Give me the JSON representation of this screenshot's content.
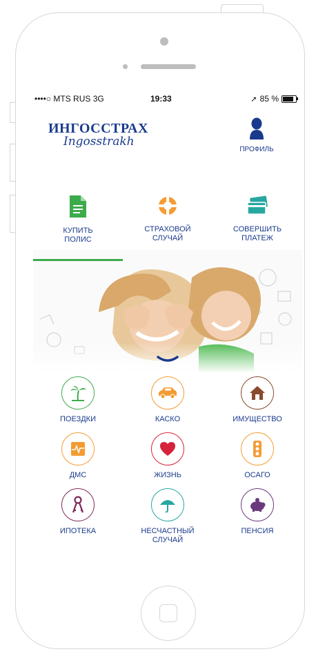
{
  "status_bar": {
    "carrier": "••••○ MTS RUS  3G",
    "time": "19:33",
    "battery": "85 %"
  },
  "header": {
    "logo_line1": "ИНГОССТРАХ",
    "logo_line2": "Ingosstrakh",
    "profile_label": "ПРОФИЛЬ"
  },
  "actions": [
    {
      "label": "КУПИТЬ\nПОЛИС",
      "icon": "document-icon"
    },
    {
      "label": "СТРАХОВОЙ\nСЛУЧАЙ",
      "icon": "lifebuoy-icon"
    },
    {
      "label": "СОВЕРШИТЬ\nПЛАТЕЖ",
      "icon": "card-icon"
    }
  ],
  "categories": [
    {
      "label": "ПОЕЗДКИ",
      "icon": "palm-icon",
      "color": "#3cab4b"
    },
    {
      "label": "КАСКО",
      "icon": "car-icon",
      "color": "#f39c34"
    },
    {
      "label": "ИМУЩЕСТВО",
      "icon": "house-icon",
      "color": "#8a4a2d"
    },
    {
      "label": "ДМС",
      "icon": "heartbeat-icon",
      "color": "#f39c34"
    },
    {
      "label": "ЖИЗНЬ",
      "icon": "heart-icon",
      "color": "#d6223a"
    },
    {
      "label": "ОСАГО",
      "icon": "traffic-light-icon",
      "color": "#f39c34"
    },
    {
      "label": "ИПОТЕКА",
      "icon": "keys-icon",
      "color": "#7d2a57"
    },
    {
      "label": "НЕСЧАСТНЫЙ\nСЛУЧАЙ",
      "icon": "umbrella-icon",
      "color": "#27a7a0"
    },
    {
      "label": "ПЕНСИЯ",
      "icon": "piggy-bank-icon",
      "color": "#6b3a7d"
    }
  ],
  "colors": {
    "brand": "#1a3a8c",
    "accent_green": "#3cab4b"
  }
}
